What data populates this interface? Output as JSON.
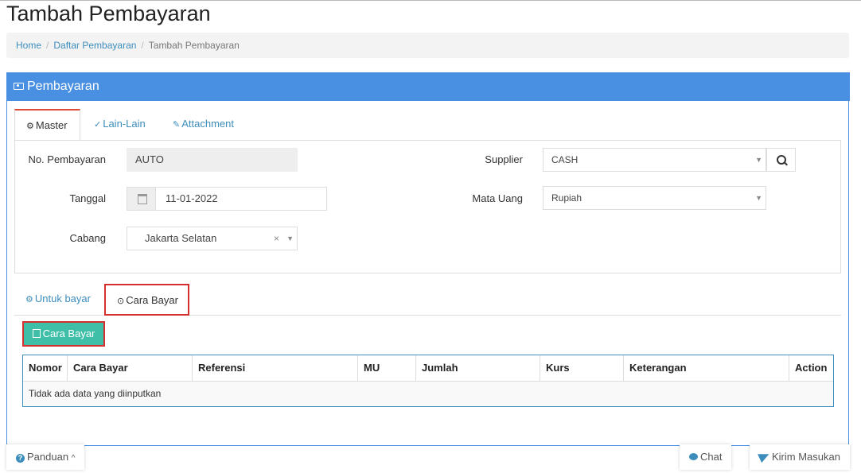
{
  "page": {
    "title": "Tambah Pembayaran"
  },
  "breadcrumb": {
    "items": [
      "Home",
      "Daftar Pembayaran"
    ],
    "active": "Tambah Pembayaran"
  },
  "panel": {
    "title": "Pembayaran"
  },
  "tabs": [
    {
      "label": "Master",
      "icon": "gears-icon",
      "active": true
    },
    {
      "label": "Lain-Lain",
      "icon": "check-circle-icon",
      "active": false
    },
    {
      "label": "Attachment",
      "icon": "paperclip-icon",
      "active": false
    }
  ],
  "form": {
    "no_pembayaran": {
      "label": "No. Pembayaran",
      "value": "AUTO"
    },
    "tanggal": {
      "label": "Tanggal",
      "value": "11-01-2022"
    },
    "cabang": {
      "label": "Cabang",
      "value": "Jakarta Selatan",
      "clear": "×"
    },
    "supplier": {
      "label": "Supplier",
      "value": "CASH"
    },
    "mata_uang": {
      "label": "Mata Uang",
      "value": "Rupiah"
    },
    "caret": "▼"
  },
  "subtabs": [
    {
      "label": "Untuk bayar",
      "icon": "gears-icon",
      "active": false
    },
    {
      "label": "Cara Bayar",
      "icon": "check-circle-icon",
      "active": true
    }
  ],
  "add_button": {
    "label": "Cara Bayar",
    "icon": "copy-icon"
  },
  "table": {
    "headers": [
      "Nomor",
      "Cara Bayar",
      "Referensi",
      "MU",
      "Jumlah",
      "Kurs",
      "Keterangan",
      "Action"
    ],
    "empty_text": "Tidak ada data yang diinputkan"
  },
  "footer": {
    "panduan": "Panduan",
    "panduan_caret": "^",
    "chat": "Chat",
    "kirim": "Kirim Masukan",
    "help_glyph": "?"
  },
  "colors": {
    "primary": "#4a90e2",
    "accent_green": "#3fbfa8",
    "highlight": "#d32f2f",
    "link": "#3c8dbc"
  }
}
